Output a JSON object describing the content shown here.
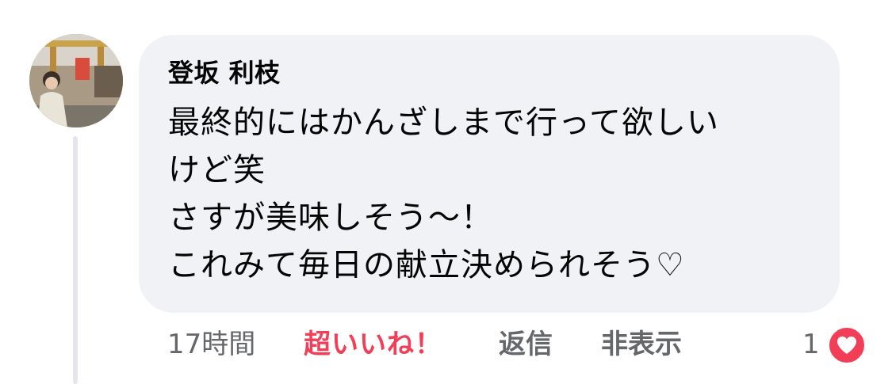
{
  "comment": {
    "author": "登坂 利枝",
    "lines": [
      "最終的にはかんざしまで行って欲しい",
      "けど笑",
      "さすが美味しそう〜！",
      "これみて毎日の献立決められそう♡"
    ]
  },
  "actions": {
    "time": "17時間",
    "reaction": "超いいね！",
    "reply": "返信",
    "hide": "非表示",
    "reaction_count": "1",
    "reaction_icon": "heart-icon"
  },
  "colors": {
    "bubble": "#f0f2f5",
    "reaction_accent": "#f33e58",
    "secondary_text": "#65676b",
    "thread_line": "#e4e6eb"
  }
}
